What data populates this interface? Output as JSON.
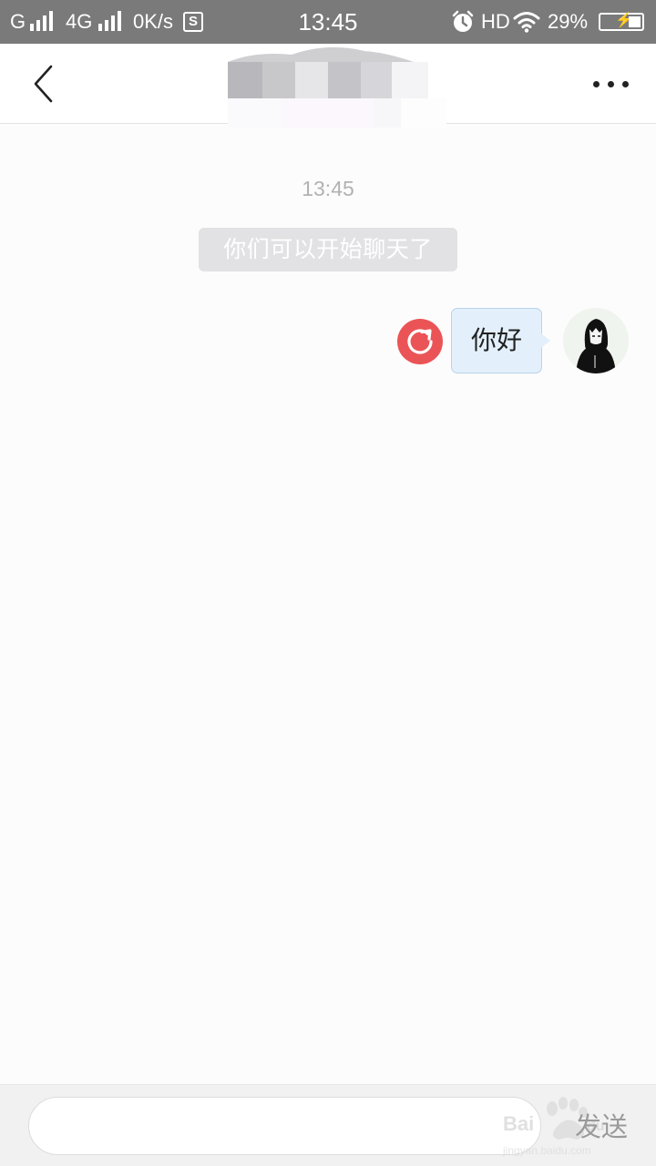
{
  "status_bar": {
    "carrier_1": "G",
    "network_type": "4G",
    "speed": "0K/s",
    "sim_icon_letter": "S",
    "time": "13:45",
    "hd_label": "HD",
    "battery_percent": "29%",
    "battery_level": 0.29,
    "icons": [
      "signal-icon",
      "sim-icon",
      "alarm-icon",
      "wifi-icon",
      "battery-charging-icon"
    ]
  },
  "header": {
    "title": "",
    "title_obscured": true,
    "icons": [
      "back-chevron-icon",
      "more-dots-icon"
    ]
  },
  "chat": {
    "timestamp": "13:45",
    "system_notice": "你们可以开始聊天了",
    "messages": [
      {
        "side": "right",
        "text": "你好",
        "status": "failed",
        "status_icon": "resend-icon",
        "avatar": "user-avatar"
      }
    ]
  },
  "input_bar": {
    "placeholder": "",
    "value": "",
    "send_label": "发送",
    "watermark": "Baidu 经验 jingyan.baidu.com"
  },
  "colors": {
    "status_bar_bg": "#7a7a7a",
    "background": "#fdfcfd",
    "bubble_bg": "#e3f0fb",
    "bubble_border": "#b8d3e9",
    "resend_red": "#eb5456",
    "system_notice_bg": "#e2e1e3",
    "timestamp_text": "#b2b2b2"
  }
}
